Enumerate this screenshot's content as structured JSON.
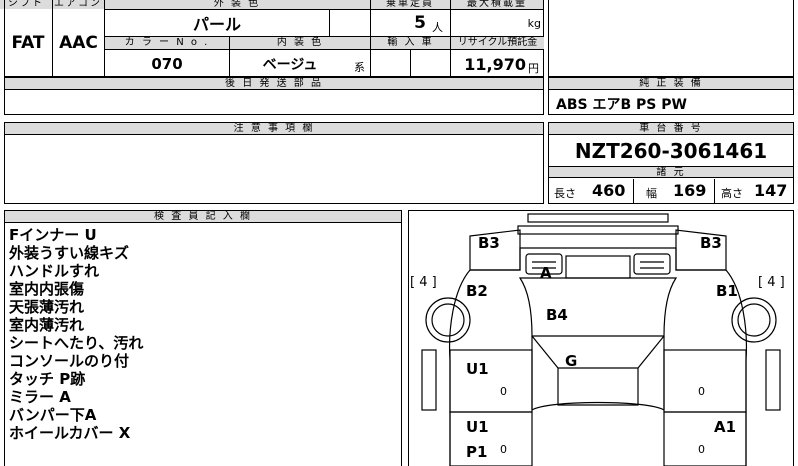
{
  "top": {
    "headers": {
      "shift": "シフト",
      "aircon": "エアコン",
      "exterior_color": "外 装 色",
      "capacity": "乗車定員",
      "max_load": "最大積載量",
      "color_no": "カ ラ ー N o .",
      "interior_color": "内 装 色",
      "import": "輸 入 車",
      "recycle": "リサイクル預託金"
    },
    "values": {
      "shift": "FAT",
      "aircon": "AAC",
      "exterior_color": "パール",
      "capacity": "5",
      "capacity_unit": "人",
      "max_load_unit": "kg",
      "color_no": "070",
      "interior_color": "ベージュ",
      "interior_suffix": "系",
      "recycle": "11,970",
      "recycle_unit": "円"
    }
  },
  "later_parts": {
    "header": "後 日 発 送 部 品",
    "value": ""
  },
  "standard_equipment": {
    "header": "純 正 装 備",
    "value": "ABS エアB PS PW"
  },
  "notes": {
    "header": "注 意 事 項 欄",
    "value": ""
  },
  "chassis": {
    "header": "車 台 番 号",
    "value": "NZT260-3061461"
  },
  "specs": {
    "header": "諸 元",
    "length_label": "長さ",
    "length": "460",
    "width_label": "幅",
    "width": "169",
    "height_label": "高さ",
    "height": "147"
  },
  "inspector": {
    "header": "検 査 員 記 入 欄",
    "lines": [
      "Fインナー U",
      "外装うすい線キズ",
      "ハンドルすれ",
      "室内内張傷",
      "天張薄汚れ",
      "室内薄汚れ",
      "シートへたり、汚れ",
      "コンソールのり付",
      "タッチ P跡",
      "ミラー A",
      "バンパー下A",
      "ホイールカバー X"
    ]
  },
  "diagram": {
    "marks": {
      "b3_left": "B3",
      "b3_right": "B3",
      "a": "A",
      "b2": "B2",
      "b1": "B1",
      "tire_left": "[ 4 ]",
      "tire_right": "[ 4 ]",
      "b4": "B4",
      "g": "G",
      "u1_left_top": "U1",
      "u1_left_bottom": "U1",
      "a1": "A1",
      "p1": "P1",
      "zero": "0"
    }
  }
}
